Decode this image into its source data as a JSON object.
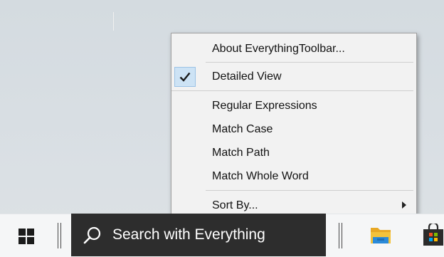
{
  "menu": {
    "items": [
      {
        "label": "About EverythingToolbar..."
      },
      {
        "label": "Detailed View",
        "checked": true
      },
      {
        "label": "Regular Expressions"
      },
      {
        "label": "Match Case"
      },
      {
        "label": "Match Path"
      },
      {
        "label": "Match Whole Word"
      },
      {
        "label": "Sort By...",
        "has_submenu": true
      }
    ]
  },
  "taskbar": {
    "search_text": "Search with Everything",
    "icons": [
      "windows-start-icon",
      "search-icon",
      "file-explorer-icon",
      "microsoft-store-icon"
    ]
  },
  "colors": {
    "taskbar_bg": "#f5f6f7",
    "search_bg": "#2d2d2d",
    "menu_bg": "#f2f2f2",
    "check_highlight": "#cde3f5",
    "folder_yellow": "#f3c23b",
    "folder_blue": "#2b8ad8"
  }
}
